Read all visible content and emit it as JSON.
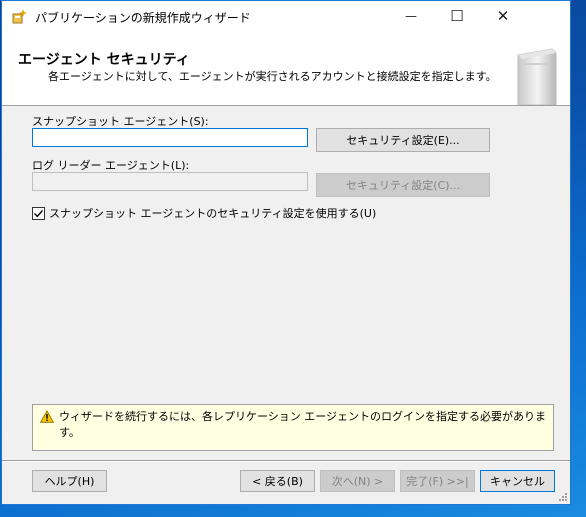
{
  "window": {
    "title": "パブリケーションの新規作成ウィザード",
    "minimize_glyph": "—",
    "maximize_glyph": "☐",
    "close_glyph": "✕"
  },
  "header": {
    "title": "エージェント セキュリティ",
    "subtitle": "各エージェントに対して、エージェントが実行されるアカウントと接続設定を指定します。"
  },
  "snapshot_agent": {
    "label": "スナップショット エージェント(S):",
    "value": "",
    "button_label": "セキュリティ設定(E)..."
  },
  "log_reader_agent": {
    "label": "ログ リーダー エージェント(L):",
    "value": "",
    "button_label": "セキュリティ設定(C)..."
  },
  "use_snapshot_security": {
    "label": "スナップショット エージェントのセキュリティ設定を使用する(U)",
    "checked": true
  },
  "message": {
    "text": "ウィザードを続行するには、各レプリケーション エージェントのログインを指定する必要があります。",
    "icon": "warning-icon"
  },
  "footer": {
    "help_label": "ヘルプ(H)",
    "back_label": "< 戻る(B)",
    "next_label": "次へ(N) >",
    "finish_label": "完了(F) >>|",
    "cancel_label": "キャンセル"
  },
  "colors": {
    "accent": "#0078d7",
    "message_bg": "#ffffe1",
    "warning": "#f5c400"
  }
}
